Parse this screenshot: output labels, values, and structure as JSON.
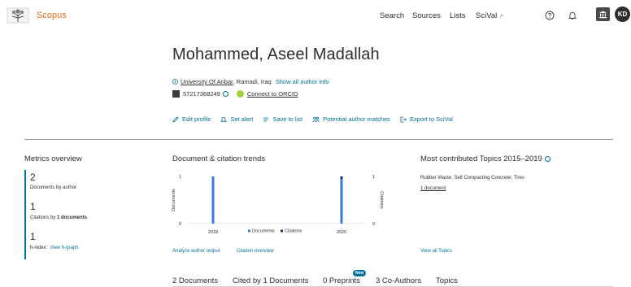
{
  "header": {
    "logo_text": "Scopus",
    "nav": [
      "Search",
      "Sources",
      "Lists",
      "SciVal"
    ],
    "scival_ext_glyph": "↗",
    "avatar_initials": "KD",
    "icons": [
      "elsevier-tree-logo",
      "help-circle-icon",
      "bell-icon",
      "institution-icon"
    ],
    "accent": "#e9711c"
  },
  "author": {
    "name": "Mohammed, Aseel Madallah",
    "affiliation_link": "University Of Anbar",
    "affiliation_location": ", Ramadi, Iraq",
    "show_all": "Show all author info",
    "author_id": "57217368249",
    "orcid": "Connect to ORCID"
  },
  "actions": [
    "Edit profile",
    "Set alert",
    "Save to list",
    "Potential author matches",
    "Export to SciVal"
  ],
  "metrics": {
    "title": "Metrics overview",
    "documents_value": "2",
    "documents_label": "Documents by author",
    "citations_value": "1",
    "citations_label_prefix": "Citations by ",
    "citations_label_strong": "1 documents",
    "hindex_value": "1",
    "hindex_label": "h-index:",
    "hindex_link": "View h-graph"
  },
  "trends": {
    "title": "Document & citation trends",
    "analyze_link": "Analyze author output",
    "citation_link": "Citation overview"
  },
  "chart_data": {
    "type": "bar",
    "categories": [
      "2018",
      "2020"
    ],
    "series": [
      {
        "name": "Documents",
        "values": [
          1,
          1
        ],
        "color": "#3b78d8"
      },
      {
        "name": "Citations",
        "values": [
          0,
          1
        ],
        "color": "#1e2b6b"
      }
    ],
    "ylabel": "Documents",
    "y2label": "Citations",
    "ylim": [
      0,
      1
    ],
    "y2lim": [
      0,
      1
    ],
    "yticks": [
      "1",
      "0"
    ],
    "y2ticks": [
      "1",
      "0"
    ],
    "legend": "bottom"
  },
  "topics": {
    "title": "Most contributed Topics 2015–2019",
    "topic": "Rubber Waste; Self Compacting Concrete; Tires",
    "docs": "1 document",
    "view_all": "View all Topics"
  },
  "tabs": [
    {
      "label": "2 Documents",
      "active": true
    },
    {
      "label": "Cited by 1 Documents",
      "active": false
    },
    {
      "label": "0 Preprints",
      "active": false
    },
    {
      "label": "3 Co-Authors",
      "active": false
    },
    {
      "label": "Topics",
      "active": false
    }
  ],
  "new_badge": "New",
  "colors": {
    "link": "#007398",
    "orcid": "#a6ce39"
  }
}
